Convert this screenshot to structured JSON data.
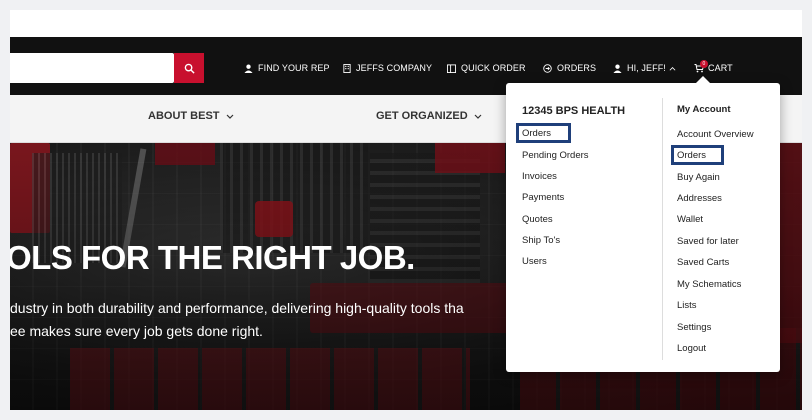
{
  "header": {
    "search": {
      "value": "",
      "placeholder": ""
    },
    "links": {
      "find_rep": "FIND YOUR REP",
      "company": "JEFFS COMPANY",
      "quick_order": "QUICK ORDER",
      "orders": "ORDERS",
      "greeting": "HI, JEFF!",
      "cart": "CART",
      "cart_count": "0"
    }
  },
  "subnav": {
    "items": [
      "ABOUT BEST",
      "GET ORGANIZED"
    ]
  },
  "hero": {
    "title": "OLS FOR THE RIGHT JOB.",
    "line1": "dustry in both durability and performance, delivering high-quality tools tha",
    "line2": "ee makes sure every job gets done right."
  },
  "account_menu": {
    "company_name": "12345 BPS HEALTH",
    "company_links": [
      "Orders",
      "Pending Orders",
      "Invoices",
      "Payments",
      "Quotes",
      "Ship To's",
      "Users"
    ],
    "account_title": "My Account",
    "account_links": [
      "Account Overview",
      "Orders",
      "Buy Again",
      "Addresses",
      "Wallet",
      "Saved for later",
      "Saved Carts",
      "My Schematics",
      "Lists",
      "Settings",
      "Logout"
    ]
  },
  "colors": {
    "header_bg": "#111111",
    "accent_red": "#c8102e",
    "highlight_border": "#1f3f7a"
  }
}
